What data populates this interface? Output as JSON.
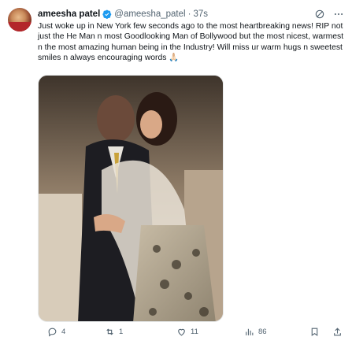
{
  "author": {
    "name": "ameesha patel",
    "handle": "@ameesha_patel",
    "separator": "·",
    "time": "37s"
  },
  "tweet": {
    "text": "Just woke up in New York few seconds ago to the most heartbreaking news! RIP not just the He Man n most Goodlooking Man of Bollywood but the most nicest, warmest n the most amazing human being in the Industry! Will miss ur warm hugs n sweetest smiles n always encouraging words 🙏🏻"
  },
  "icons": {
    "verified": "verified-badge-icon",
    "grok": "grok-icon",
    "more": "more-icon",
    "reply": "reply-icon",
    "retweet": "retweet-icon",
    "like": "like-icon",
    "views": "views-icon",
    "bookmark": "bookmark-icon",
    "share": "share-icon"
  },
  "actions": {
    "replies": "4",
    "retweets": "1",
    "likes": "11",
    "views": "86"
  },
  "colors": {
    "text": "#0f1419",
    "secondary": "#536471",
    "verified": "#1d9bf0"
  }
}
